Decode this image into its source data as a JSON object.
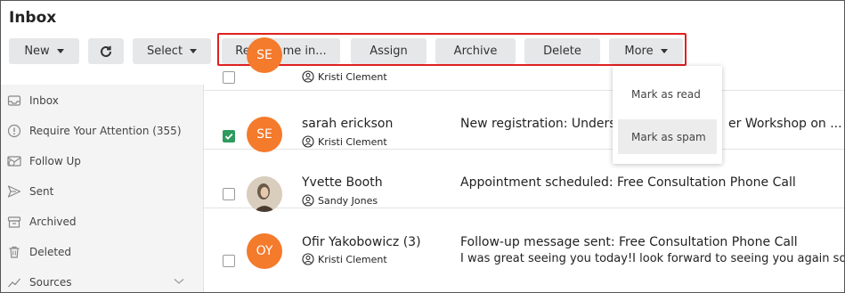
{
  "page": {
    "title": "Inbox"
  },
  "toolbar": {
    "new_label": "New",
    "select_label": "Select",
    "remind_label": "Remind me in...",
    "assign_label": "Assign",
    "archive_label": "Archive",
    "delete_label": "Delete",
    "more_label": "More"
  },
  "sidebar": {
    "items": [
      {
        "label": "Inbox",
        "icon": "inbox-icon"
      },
      {
        "label": "Require Your Attention (355)",
        "icon": "alert-circle-icon"
      },
      {
        "label": "Follow Up",
        "icon": "follow-up-icon"
      },
      {
        "label": "Sent",
        "icon": "send-icon"
      },
      {
        "label": "Archived",
        "icon": "archive-icon"
      },
      {
        "label": "Deleted",
        "icon": "trash-icon"
      },
      {
        "label": "Sources",
        "icon": "trend-icon"
      }
    ]
  },
  "messages": [
    {
      "initials": "SE",
      "owner": "Kristi Clement",
      "checked": false
    },
    {
      "initials": "SE",
      "name": "sarah erickson",
      "owner": "Kristi Clement",
      "subject": "New registration: Underst",
      "subject_tail": "er Workshop on ...",
      "checked": true
    },
    {
      "name": "Yvette Booth",
      "owner": "Sandy Jones",
      "subject": "Appointment scheduled: Free Consultation Phone Call",
      "checked": false
    },
    {
      "initials": "OY",
      "name": "Ofir Yakobowicz (3)",
      "owner": "Kristi Clement",
      "subject": "Follow-up message sent: Free Consultation Phone Call",
      "preview": "I was great seeing you today!I look forward to seeing you again soon.",
      "checked": false
    }
  ],
  "more_menu": {
    "items": [
      {
        "label": "Mark as read"
      },
      {
        "label": "Mark as spam"
      }
    ]
  },
  "colors": {
    "avatar": "#f47a2c",
    "checkbox_checked": "#2e9b5e",
    "highlight": "#e02020"
  }
}
